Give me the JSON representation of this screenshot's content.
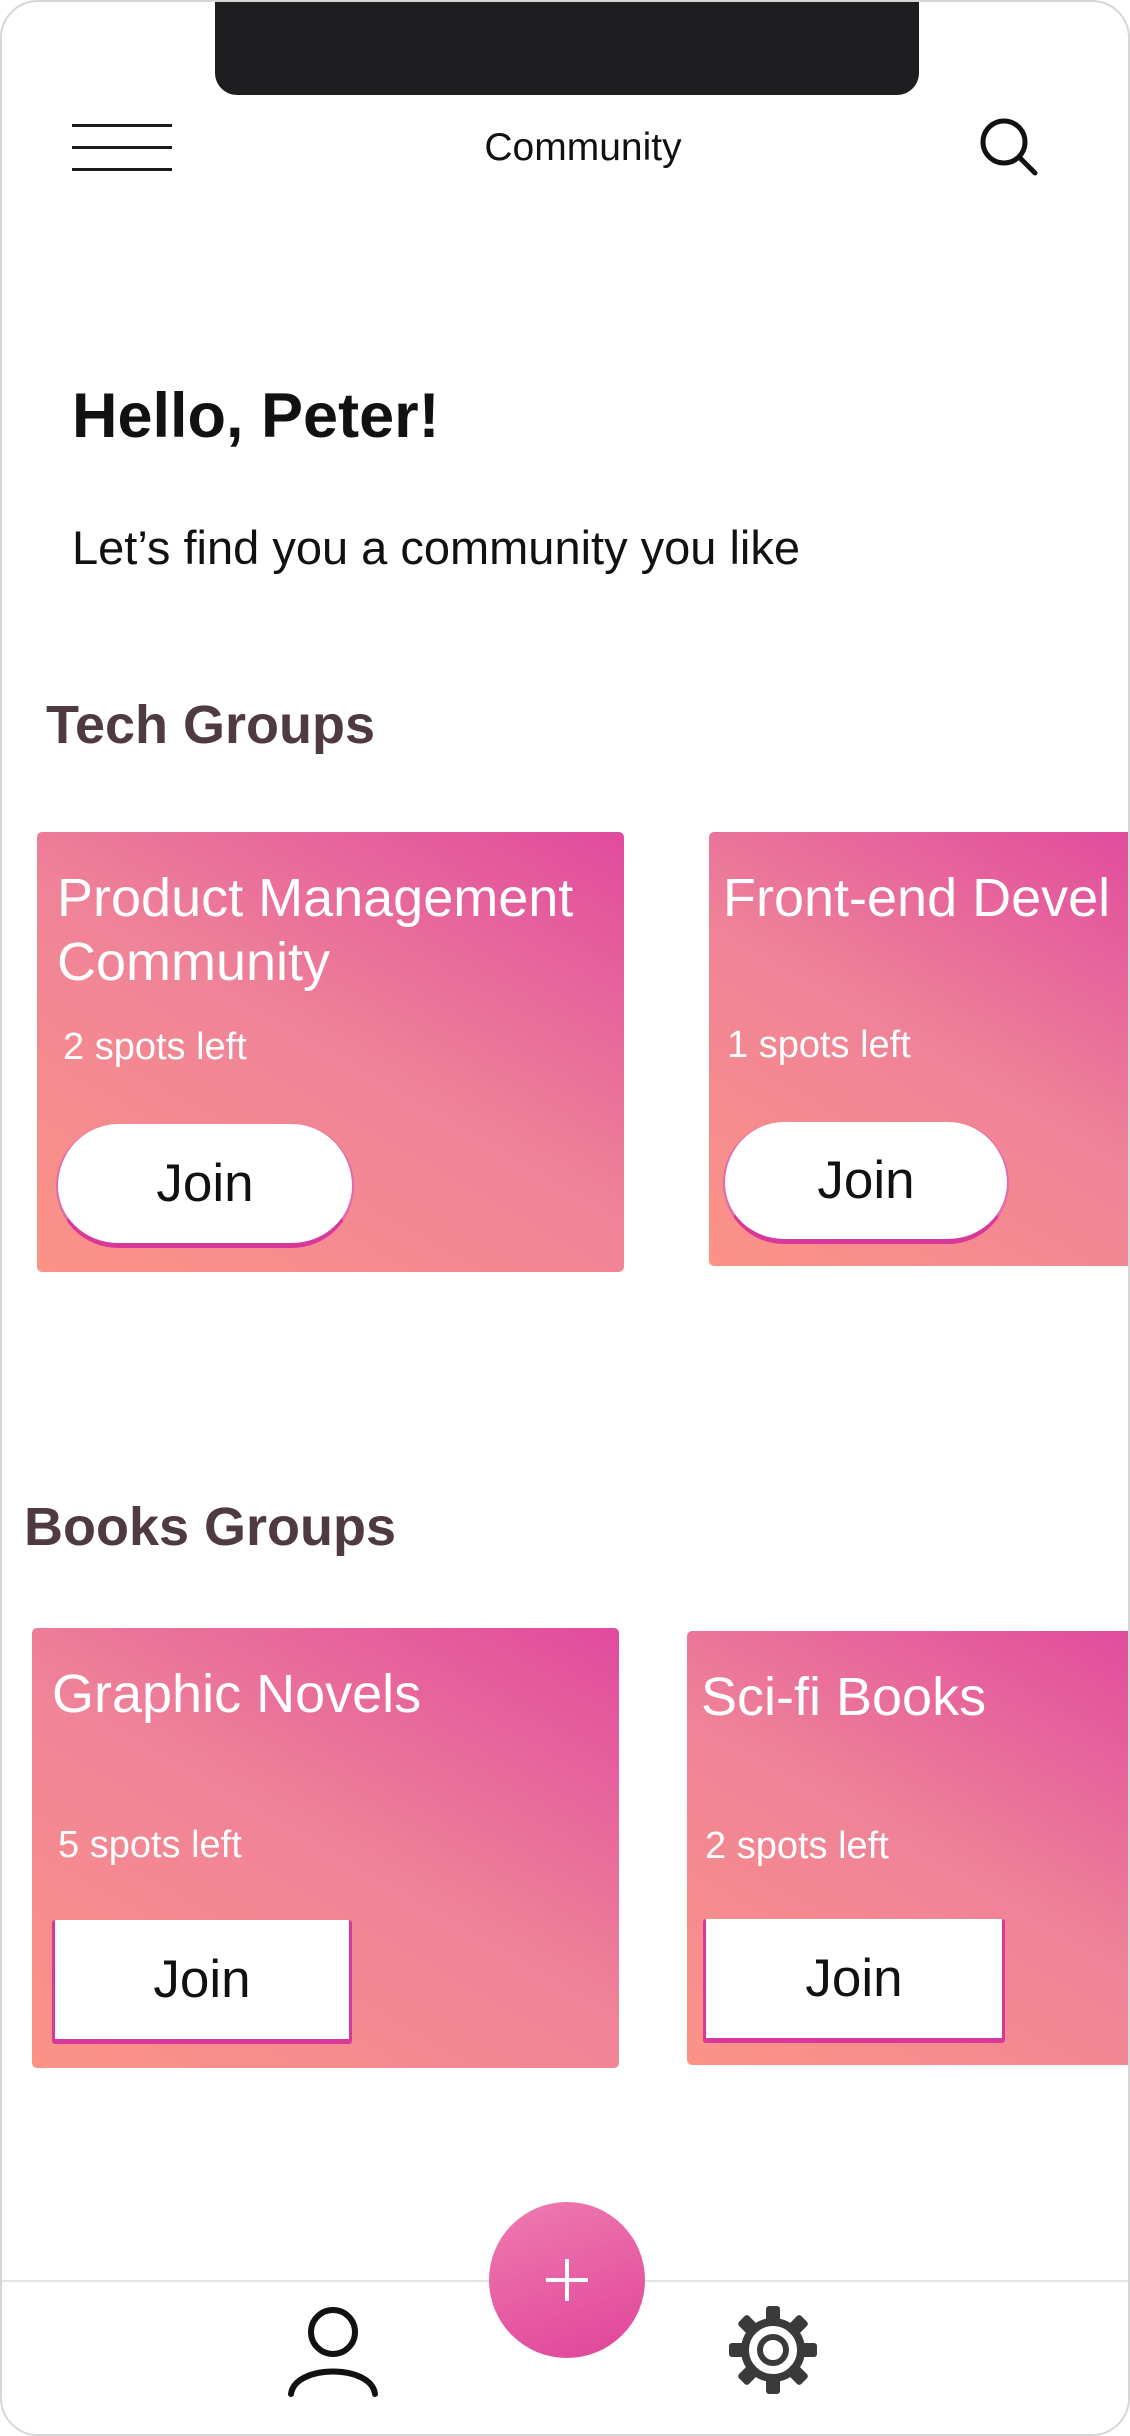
{
  "header": {
    "title": "Community"
  },
  "greeting": {
    "title": "Hello, Peter!",
    "subtitle": "Let’s find you a community you like"
  },
  "sections": [
    {
      "title": "Tech Groups",
      "cards": [
        {
          "title_line1": "Product Management",
          "title_line2": "Community",
          "spots": "2 spots left",
          "button": "Join"
        },
        {
          "title_line1": "Front-end Devel",
          "spots": "1 spots left",
          "button": "Join"
        }
      ]
    },
    {
      "title": "Books Groups",
      "cards": [
        {
          "title_line1": "Graphic Novels",
          "spots": "5 spots left",
          "button": "Join"
        },
        {
          "title_line1": "Sci-fi Books",
          "spots": "2 spots left",
          "button": "Join"
        }
      ]
    }
  ],
  "icons": {
    "menu": "hamburger-menu-icon",
    "search": "search-icon",
    "profile": "user-icon",
    "add": "plus-icon",
    "settings": "gear-icon"
  },
  "colors": {
    "accent": "#e0449a",
    "card_gradient_start": "#fc9386",
    "card_gradient_end": "#e04b9e",
    "section_title": "#4e3a40"
  }
}
